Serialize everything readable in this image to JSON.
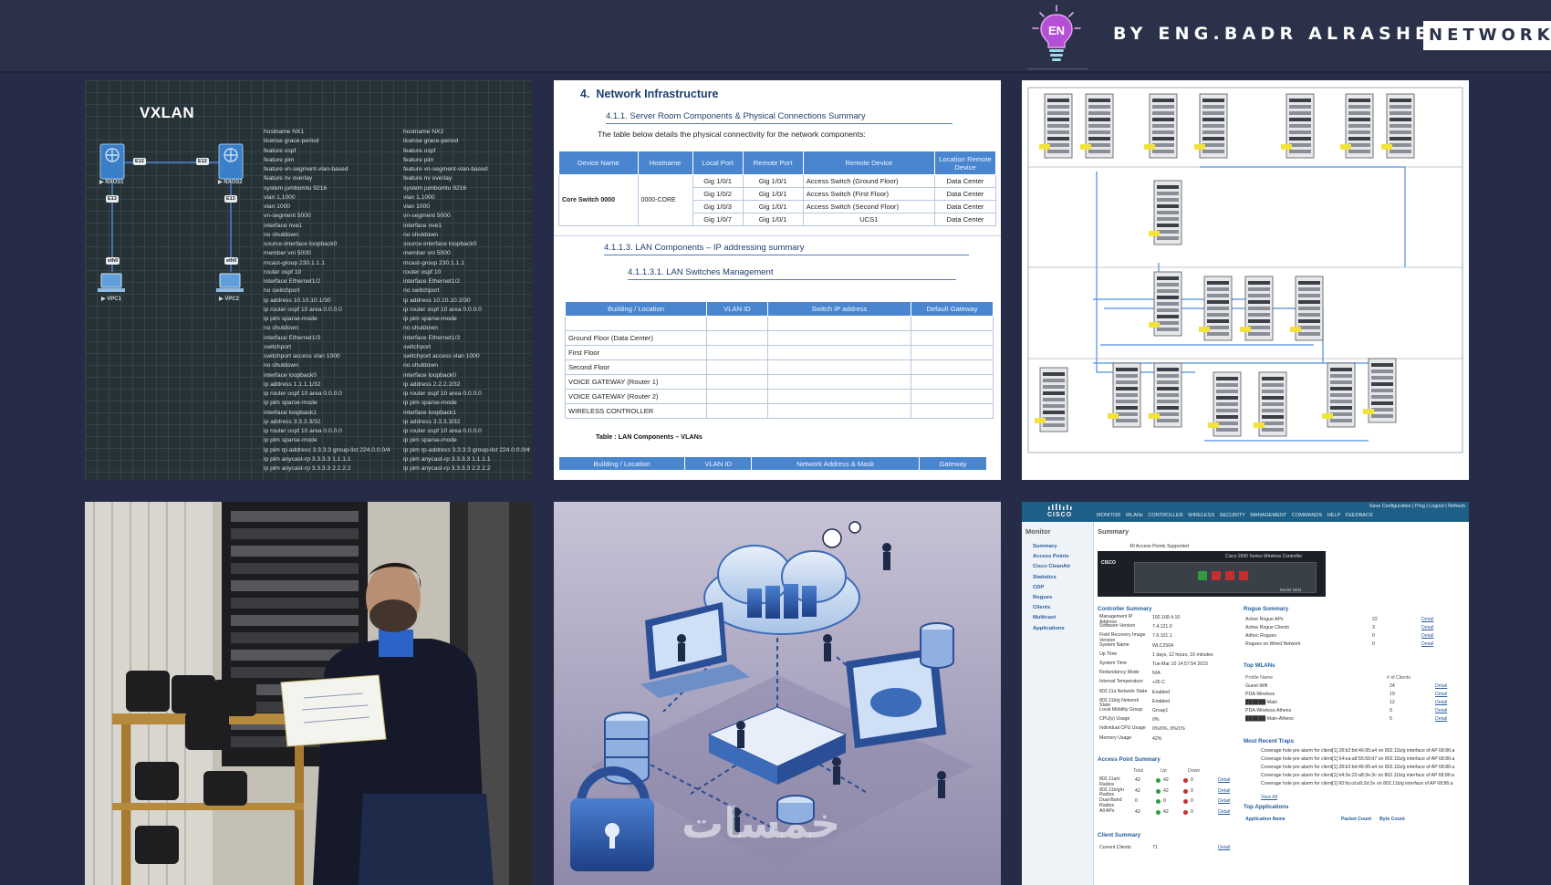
{
  "header": {
    "logo_text": "EN",
    "byline": "BY ENG.BADR ALRASHEED",
    "badge": "NETWORK E"
  },
  "tiles": {
    "vxlan": {
      "title": "VXLAN",
      "nodes": [
        "NXOS1",
        "NXOS2",
        "VPC1",
        "VPC2"
      ],
      "ifaces": [
        "E12",
        "E12",
        "E13",
        "E13",
        "eth0",
        "eth0"
      ],
      "config_left": "hostname NX1\nlicense grace-period\nfeature ospf\nfeature pim\nfeature vn-segment-vlan-based\nfeature nv overlay\nsystem jumbomtu 9216\nvlan 1,1000\nvlan 1000\nvn-segment 5000\ninterface nve1\nno shutdown\nsource-interface loopback0\nmember vni 5000\nmcast-group 230.1.1.1\nrouter ospf 10\ninterface Ethernet1/2\nno switchport\nip address 10.10.10.1/30\nip router ospf 10 area 0.0.0.0\nip pim sparse-mode\nno shutdown\ninterface Ethernet1/3\nswitchport\nswitchport access vlan 1000\nno shutdown\ninterface loopback0\nip address 1.1.1.1/32\nip router ospf 10 area 0.0.0.0\nip pim sparse-mode\ninterface loopback1\nip address 3.3.3.3/32\nip router ospf 10 area 0.0.0.0\nip pim sparse-mode\nip pim rp-address 3.3.3.3 group-list 224.0.0.0/4\nip pim anycast-rp 3.3.3.3 1.1.1.1\nip pim anycast-rp 3.3.3.3 2.2.2.2",
      "config_right": "hostname NX2\nlicense grace-period\nfeature ospf\nfeature pim\nfeature vn-segment-vlan-based\nfeature nv overlay\nsystem jumbomtu 9216\nvlan 1,1000\nvlan 1000\nvn-segment 5000\ninterface nve1\nno shutdown\nsource-interface loopback0\nmember vni 5000\nmcast-group 230.1.1.1\nrouter ospf 10\ninterface Ethernet1/2\nno switchport\nip address 10.10.10.2/30\nip router ospf 10 area 0.0.0.0\nip pim sparse-mode\nno shutdown\ninterface Ethernet1/3\nswitchport\nswitchport access vlan 1000\nno shutdown\ninterface loopback0\nip address 2.2.2.2/32\nip router ospf 10 area 0.0.0.0\nip pim sparse-mode\ninterface loopback1\nip address 3.3.3.3/32\nip router ospf 10 area 0.0.0.0\nip pim sparse-mode\nip pim rp-address 3.3.3.3 group-list 224.0.0.0/4\nip pim anycast-rp 3.3.3.3 1.1.1.1\nip pim anycast-rp 3.3.3.3 2.2.2.2"
    },
    "doc": {
      "h1_num": "4.",
      "h1": "Network Infrastructure",
      "h2_a": "4.1.1.   Server Room Components & Physical Connections Summary",
      "intro": "The table below details the physical connectivity for the network components:",
      "t1_headers": [
        "Device Name",
        "Hostname",
        "Local Port",
        "Remote Port",
        "Remote Device",
        "Location Remote Device"
      ],
      "t1_device": "Core Switch 0000",
      "t1_hostname": "0000-CORE",
      "t1_rows": [
        [
          "Gig 1/0/1",
          "Gig 1/0/1",
          "Access Switch (Ground Floor)",
          "Data Center"
        ],
        [
          "Gig 1/0/2",
          "Gig 1/0/1",
          "Access Switch (First Floor)",
          "Data Center"
        ],
        [
          "Gig 1/0/3",
          "Gig 1/0/1",
          "Access Switch (Second Floor)",
          "Data Center"
        ],
        [
          "Gig 1/0/7",
          "Gig 1/0/1",
          "UCS1",
          "Data Center"
        ]
      ],
      "h2_b": "4.1.1.3.      LAN Components – IP addressing summary",
      "h2_c": "4.1.1.3.1.                    LAN Switches Management",
      "t2_headers": [
        "Building / Location",
        "VLAN ID",
        "Switch IP address",
        "Default Gateway"
      ],
      "t2_rows": [
        "",
        "Ground Floor (Data Center)",
        "First Floor",
        "Second Floor",
        "VOICE GATEWAY (Router 1)",
        "VOICE GATEWAY (Router 2)",
        "WIRELESS CONTROLLER"
      ],
      "caption": "Table : LAN Components – VLANs",
      "t3_headers": [
        "Building / Location",
        "VLAN ID",
        "Network Address & Mask",
        "Gateway"
      ]
    },
    "cisco": {
      "logo": "cisco",
      "nav": "MONITOR  WLANs  CONTROLLER  WIRELESS  SECURITY  MANAGEMENT  COMMANDS  HELP  FEEDBACK",
      "nav_top": "Save Configuration  |  Ping  |  Logout  |  Refresh",
      "side_title": "Monitor",
      "side_items": [
        "Summary",
        "Access Points",
        "Cisco CleanAir",
        "Statistics",
        "CDP",
        "Rogues",
        "Clients",
        "Multicast",
        "Applications"
      ],
      "page_title": "Summary",
      "ap_supported": "40 Access Points Supported",
      "device_label": "Cisco 2500 Series Wireless Controller",
      "device_model": "Model 2504",
      "controller_summary_title": "Controller Summary",
      "controller_summary": [
        [
          "Management IP Address",
          "192.168.4.10"
        ],
        [
          "Software Version",
          "7.4.121.0"
        ],
        [
          "Field Recovery Image Version",
          "7.6.101.1"
        ],
        [
          "System Name",
          "WLC2504"
        ],
        [
          "Up Time",
          "1 days, 12 hours, 16 minutes"
        ],
        [
          "System Time",
          "Tue Mar 10 14:57:54 2015"
        ],
        [
          "Redundancy Mode",
          "N/A"
        ],
        [
          "Internal Temperature",
          "+26 C"
        ],
        [
          "802.11a Network State",
          "Enabled"
        ],
        [
          "802.11b/g Network State",
          "Enabled"
        ],
        [
          "Local Mobility Group",
          "Group1"
        ],
        [
          "CPU(s) Usage",
          "0%"
        ],
        [
          "Individual CPU Usage",
          "0%/0%, 0%/1%"
        ],
        [
          "Memory Usage",
          "42%"
        ]
      ],
      "rogue_summary_title": "Rogue Summary",
      "rogue_summary": [
        [
          "Active Rogue APs",
          "22"
        ],
        [
          "Active Rogue Clients",
          "3"
        ],
        [
          "Adhoc Rogues",
          "0"
        ],
        [
          "Rogues on Wired Network",
          "0"
        ]
      ],
      "detail": "Detail",
      "top_wlans_title": "Top WLANs",
      "top_wlans_headers": [
        "Profile Name",
        "# of Clients"
      ],
      "top_wlans": [
        [
          "Guest-Wifi",
          "24"
        ],
        [
          "PDA-Wireless",
          "19"
        ],
        [
          "██████-Main",
          "12"
        ],
        [
          "PDA-Wireless-Athens",
          "9"
        ],
        [
          "██████-Main-Athens",
          "5"
        ]
      ],
      "traps_title": "Most Recent Traps",
      "traps": [
        "Coverage hole pre alarm for client[1] 28:b2:bd:46:95:a4 on 802.11b/g interface of AP 68:86:a",
        "Coverage hole pre alarm for client[1] 54:ea:a8:55:69:d7 on 802.11b/g interface of AP 68:86:a",
        "Coverage hole pre alarm for client[1] 28:b2:bd:46:95:a4 on 802.11b/g interface of AP 68:86:a",
        "Coverage hole pre alarm for client[1] b4:3e:20:a8:3e:3c on 802.11b/g interface of AP 68:86:a",
        "Coverage hole pre alarm for client[1] 60:fa:cd:a9:2d:2e on 802.11b/g interface of AP 68:86:a"
      ],
      "view_all": "View All",
      "top_apps_title": "Top Applications",
      "top_apps_headers": [
        "Application Name",
        "Packet Count",
        "Byte Count"
      ],
      "ap_summary_title": "Access Point Summary",
      "ap_headers": [
        "Total",
        "Up",
        "Down"
      ],
      "ap_rows": [
        [
          "802.11a/n Radios",
          "42",
          "42",
          "0"
        ],
        [
          "802.11b/g/n Radios",
          "42",
          "42",
          "0"
        ],
        [
          "Dual-Band Radios",
          "0",
          "0",
          "0"
        ],
        [
          "All APs",
          "42",
          "42",
          "0"
        ]
      ],
      "client_summary_title": "Client Summary",
      "current_clients_label": "Current Clients",
      "current_clients": "71"
    },
    "cloud": {
      "watermark": "خمسات"
    }
  },
  "colors": {
    "background": "#262c47",
    "header": "#2a3149",
    "doc_table_header": "#4a86d0",
    "cisco_header": "#1e5f87"
  }
}
